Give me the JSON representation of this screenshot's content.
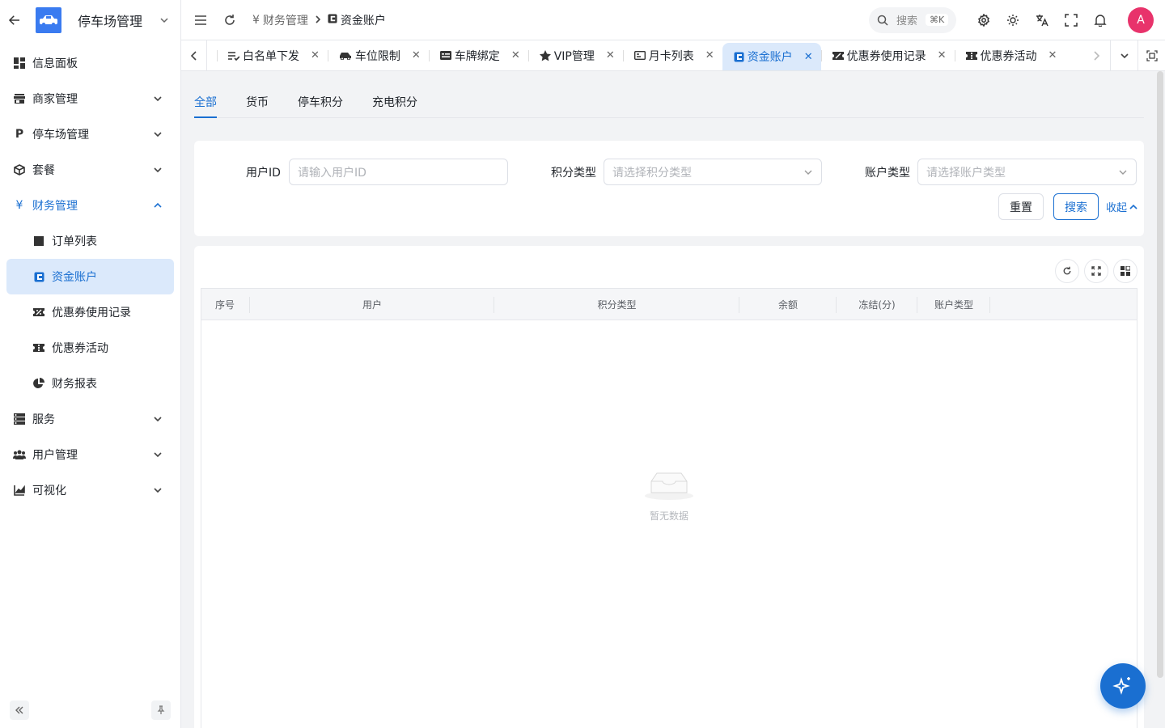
{
  "app": {
    "title": "停车场管理",
    "brand_color": "#3a7bf0",
    "accent": "#1a6fd1"
  },
  "sidebar": {
    "items": [
      {
        "label": "信息面板",
        "icon": "dashboard-icon"
      },
      {
        "label": "商家管理",
        "icon": "store-icon"
      },
      {
        "label": "停车场管理",
        "icon": "parking-icon"
      },
      {
        "label": "套餐",
        "icon": "package-icon"
      },
      {
        "label": "财务管理",
        "icon": "yuan-icon",
        "expanded": true,
        "children": [
          {
            "label": "订单列表",
            "icon": "square-icon"
          },
          {
            "label": "资金账户",
            "icon": "wallet-icon",
            "selected": true
          },
          {
            "label": "优惠券使用记录",
            "icon": "coupon-icon"
          },
          {
            "label": "优惠券活动",
            "icon": "ticket-icon"
          },
          {
            "label": "财务报表",
            "icon": "pie-chart-icon"
          }
        ]
      },
      {
        "label": "服务",
        "icon": "server-icon"
      },
      {
        "label": "用户管理",
        "icon": "users-icon"
      },
      {
        "label": "可视化",
        "icon": "area-chart-icon"
      }
    ]
  },
  "header": {
    "breadcrumb": [
      {
        "label": "财务管理",
        "icon": "yuan-icon"
      },
      {
        "label": "资金账户",
        "icon": "wallet-icon"
      }
    ],
    "search": {
      "label": "搜索",
      "shortcut": "⌘K"
    },
    "avatar": "A"
  },
  "tabs": [
    {
      "label": "白名单下发",
      "icon": "playlist-icon"
    },
    {
      "label": "车位限制",
      "icon": "car-icon"
    },
    {
      "label": "车牌绑定",
      "icon": "plate-icon"
    },
    {
      "label": "VIP管理",
      "icon": "star-icon"
    },
    {
      "label": "月卡列表",
      "icon": "card-icon"
    },
    {
      "label": "资金账户",
      "icon": "wallet-icon",
      "active": true
    },
    {
      "label": "优惠券使用记录",
      "icon": "coupon-icon"
    },
    {
      "label": "优惠券活动",
      "icon": "ticket-icon"
    }
  ],
  "type_tabs": [
    "全部",
    "货币",
    "停车积分",
    "充电积分"
  ],
  "filters": {
    "user_id": {
      "label": "用户ID",
      "placeholder": "请输入用户ID"
    },
    "points_type": {
      "label": "积分类型",
      "placeholder": "请选择积分类型"
    },
    "account_type": {
      "label": "账户类型",
      "placeholder": "请选择账户类型"
    },
    "reset": "重置",
    "search": "搜索",
    "collapse": "收起"
  },
  "table": {
    "columns": [
      "序号",
      "用户",
      "积分类型",
      "余额",
      "冻结(分)",
      "账户类型"
    ],
    "rows": [],
    "empty_text": "暂无数据"
  }
}
